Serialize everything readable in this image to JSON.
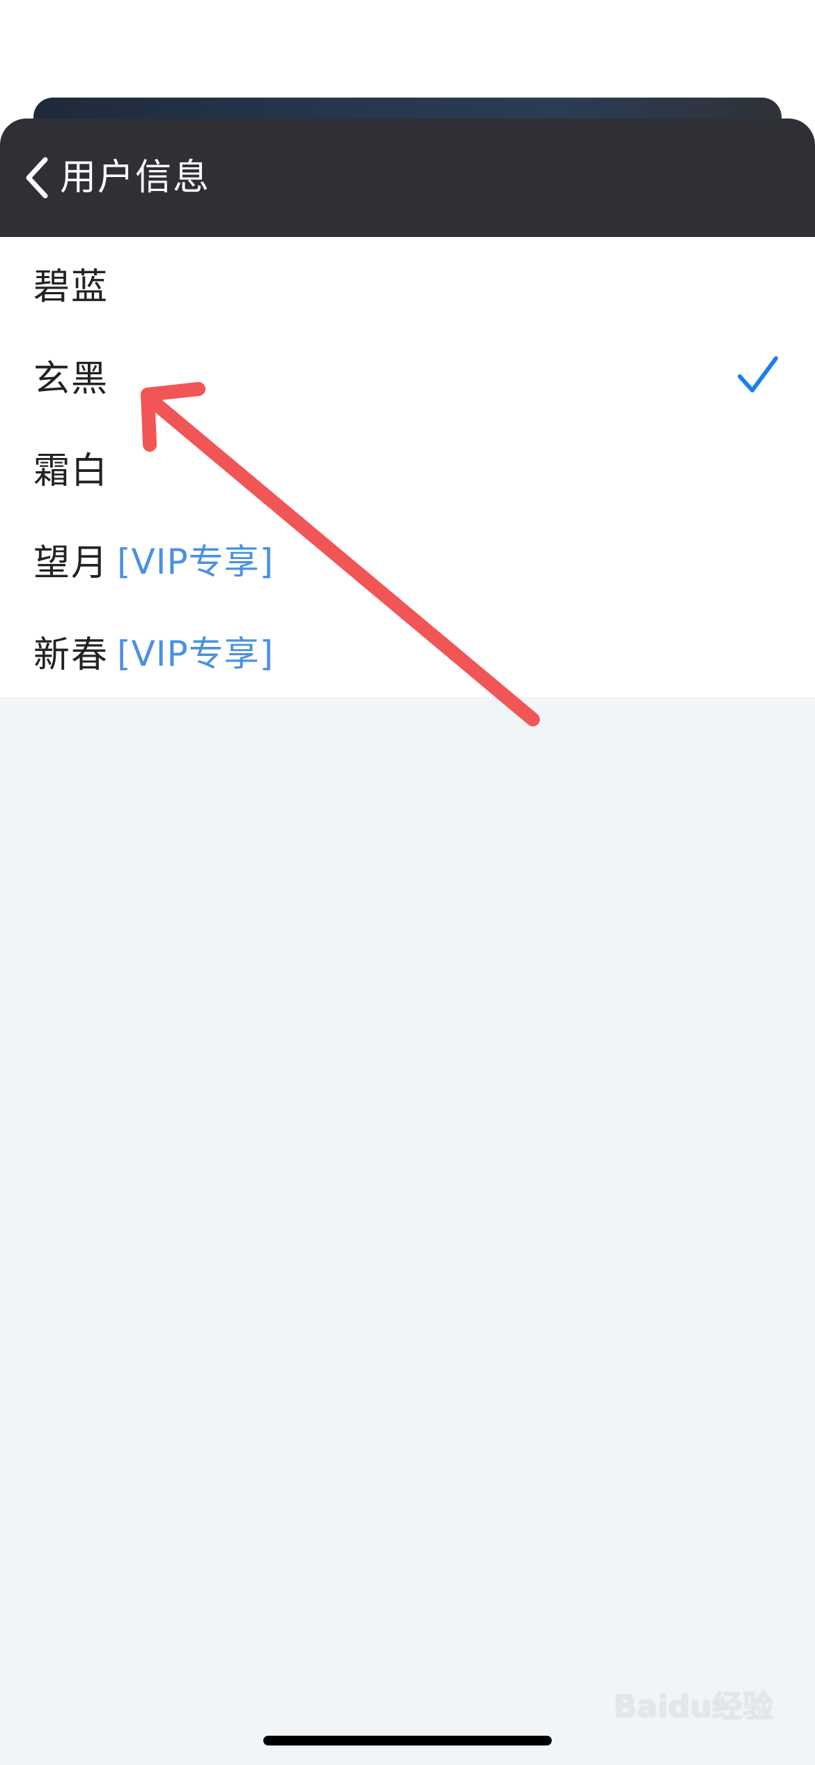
{
  "header": {
    "title": "用户信息"
  },
  "themes": [
    {
      "name": "碧蓝",
      "tag": "",
      "selected": false
    },
    {
      "name": "玄黑",
      "tag": "",
      "selected": true
    },
    {
      "name": "霜白",
      "tag": "",
      "selected": false
    },
    {
      "name": "望月",
      "tag": "[VIP专享]",
      "selected": false
    },
    {
      "name": "新春",
      "tag": "[VIP专享]",
      "selected": false
    }
  ],
  "watermark": "Baidu经验",
  "colors": {
    "header_bg": "#2f3035",
    "accent_blue": "#4a90e2",
    "check_blue": "#1a7ff0",
    "annotation_red": "#f25555"
  },
  "icons": {
    "back": "chevron-left-icon",
    "check": "checkmark-icon",
    "annotation": "arrow-annotation-icon"
  }
}
